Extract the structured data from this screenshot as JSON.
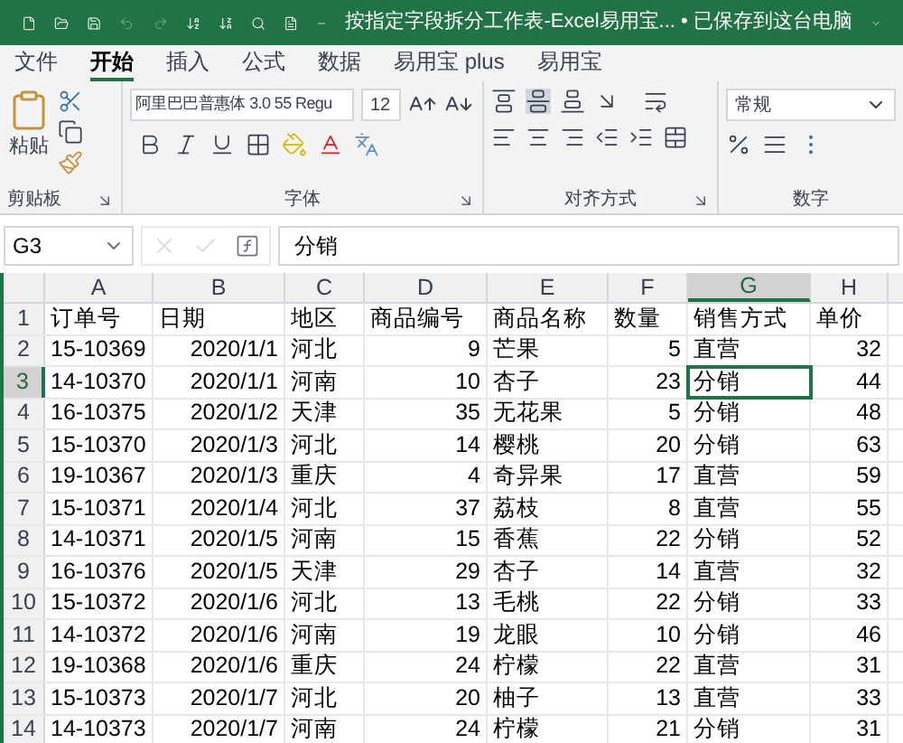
{
  "window": {
    "title": "按指定字段拆分工作表-Excel易用宝... • 已保存到这台电脑"
  },
  "tabs": [
    {
      "label": "文件",
      "selected": false
    },
    {
      "label": "开始",
      "selected": true
    },
    {
      "label": "插入",
      "selected": false
    },
    {
      "label": "公式",
      "selected": false
    },
    {
      "label": "数据",
      "selected": false
    },
    {
      "label": "易用宝 plus",
      "selected": false
    },
    {
      "label": "易用宝",
      "selected": false
    }
  ],
  "ribbon": {
    "paste_label": "粘贴",
    "font_name": "阿里巴巴普惠体 3.0 55 Regu",
    "font_size": "12",
    "number_format": "常规",
    "groups": [
      "剪贴板",
      "字体",
      "对齐方式",
      "数字"
    ]
  },
  "formula_bar": {
    "name_box": "G3",
    "value": "分销"
  },
  "columns": [
    {
      "label": "A",
      "kind": "text",
      "selected": false
    },
    {
      "label": "B",
      "kind": "number",
      "selected": false
    },
    {
      "label": "C",
      "kind": "text",
      "selected": false
    },
    {
      "label": "D",
      "kind": "number",
      "selected": false
    },
    {
      "label": "E",
      "kind": "text",
      "selected": false
    },
    {
      "label": "F",
      "kind": "number",
      "selected": false
    },
    {
      "label": "G",
      "kind": "text",
      "selected": true
    },
    {
      "label": "H",
      "kind": "number",
      "selected": false
    }
  ],
  "rows": [
    {
      "number": "1",
      "kind": "header",
      "selected": false,
      "cells": [
        "订单号",
        "日期",
        "地区",
        "商品编号",
        "商品名称",
        "数量",
        "销售方式",
        "单价"
      ]
    },
    {
      "number": "2",
      "kind": "data",
      "selected": false,
      "cells": [
        "15-10369",
        "2020/1/1",
        "河北",
        "9",
        "芒果",
        "5",
        "直营",
        "32"
      ]
    },
    {
      "number": "3",
      "kind": "data",
      "selected": true,
      "cells": [
        "14-10370",
        "2020/1/1",
        "河南",
        "10",
        "杏子",
        "23",
        "分销",
        "44"
      ]
    },
    {
      "number": "4",
      "kind": "data",
      "selected": false,
      "cells": [
        "16-10375",
        "2020/1/2",
        "天津",
        "35",
        "无花果",
        "5",
        "分销",
        "48"
      ]
    },
    {
      "number": "5",
      "kind": "data",
      "selected": false,
      "cells": [
        "15-10370",
        "2020/1/3",
        "河北",
        "14",
        "樱桃",
        "20",
        "分销",
        "63"
      ]
    },
    {
      "number": "6",
      "kind": "data",
      "selected": false,
      "cells": [
        "19-10367",
        "2020/1/3",
        "重庆",
        "4",
        "奇异果",
        "17",
        "直营",
        "59"
      ]
    },
    {
      "number": "7",
      "kind": "data",
      "selected": false,
      "cells": [
        "15-10371",
        "2020/1/4",
        "河北",
        "37",
        "荔枝",
        "8",
        "直营",
        "55"
      ]
    },
    {
      "number": "8",
      "kind": "data",
      "selected": false,
      "cells": [
        "14-10371",
        "2020/1/5",
        "河南",
        "15",
        "香蕉",
        "22",
        "分销",
        "52"
      ]
    },
    {
      "number": "9",
      "kind": "data",
      "selected": false,
      "cells": [
        "16-10376",
        "2020/1/5",
        "天津",
        "29",
        "杏子",
        "14",
        "直营",
        "32"
      ]
    },
    {
      "number": "10",
      "kind": "data",
      "selected": false,
      "cells": [
        "15-10372",
        "2020/1/6",
        "河北",
        "13",
        "毛桃",
        "22",
        "分销",
        "33"
      ]
    },
    {
      "number": "11",
      "kind": "data",
      "selected": false,
      "cells": [
        "14-10372",
        "2020/1/6",
        "河南",
        "19",
        "龙眼",
        "10",
        "分销",
        "46"
      ]
    },
    {
      "number": "12",
      "kind": "data",
      "selected": false,
      "cells": [
        "19-10368",
        "2020/1/6",
        "重庆",
        "24",
        "柠檬",
        "22",
        "直营",
        "31"
      ]
    },
    {
      "number": "13",
      "kind": "data",
      "selected": false,
      "cells": [
        "15-10373",
        "2020/1/7",
        "河北",
        "20",
        "柚子",
        "13",
        "直营",
        "33"
      ]
    },
    {
      "number": "14",
      "kind": "data",
      "selected": false,
      "cells": [
        "14-10373",
        "2020/1/7",
        "河南",
        "24",
        "柠檬",
        "21",
        "分销",
        "31"
      ]
    }
  ]
}
